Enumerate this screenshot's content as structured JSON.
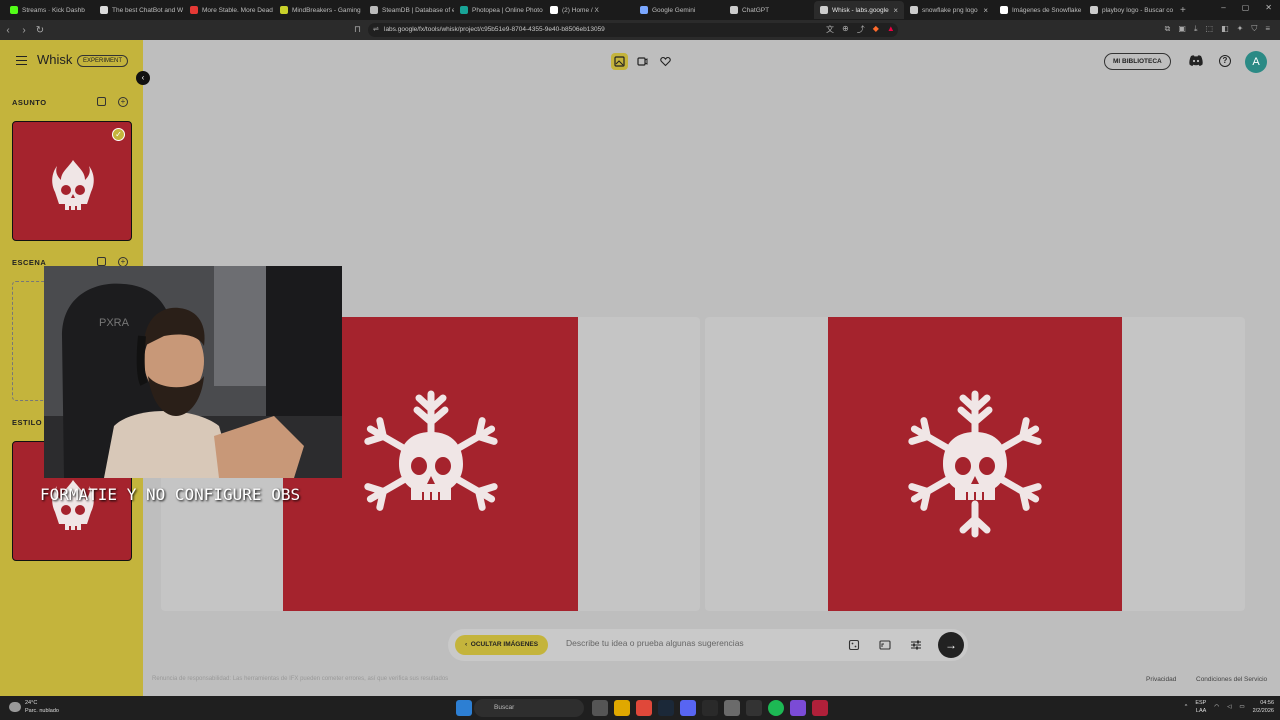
{
  "browser": {
    "tabs": [
      {
        "label": "Streams · Kick Dashb",
        "color": "#53fc18"
      },
      {
        "label": "The best ChatBot and W",
        "color": "#dddddd"
      },
      {
        "label": "More Stable. More Dead",
        "color": "#e53935"
      },
      {
        "label": "MindBreakers - Gaming",
        "color": "#c9d12a"
      },
      {
        "label": "SteamDB | Database of e",
        "color": "#bbbbbb"
      },
      {
        "label": "Photopea | Online Photo",
        "color": "#18a497"
      },
      {
        "label": "(2) Home / X",
        "color": "#ffffff"
      },
      {
        "label": "Google Gemini",
        "color": "#7aa7ff"
      },
      {
        "label": "ChatGPT",
        "color": "#cccccc"
      },
      {
        "label": "Whisk - labs.google",
        "color": "#cccccc"
      },
      {
        "label": "snowflake png logo",
        "color": "#cccccc"
      },
      {
        "label": "Imágenes de Snowflake",
        "color": "#ffffff"
      },
      {
        "label": "playboy logo - Buscar co",
        "color": "#cccccc"
      }
    ],
    "active_tab_index": 9,
    "url": "labs.google/fx/tools/whisk/project/c95b51e9-8704-4355-9e40-b8506eb13059",
    "window_controls": [
      "–",
      "▢",
      "✕"
    ],
    "new_tab": "+"
  },
  "app": {
    "logo": "Whisk",
    "badge": "EXPERIMENT",
    "sections": {
      "subject": "ASUNTO",
      "scene": "ESCENA",
      "style": "ESTILO"
    },
    "library_button": "MI BIBLIOTECA",
    "avatar_initial": "A",
    "hide_images_button": "OCULTAR IMÁGENES",
    "prompt_placeholder": "Describe tu idea o prueba algunas sugerencias",
    "disclaimer": "Renuncia de responsabilidad: Las herramientas de IFX pueden cometer errores, así que verifica sus resultados",
    "privacy_link": "Privacidad",
    "terms_link": "Condiciones del Servicio",
    "accent_color": "#c4b43c",
    "image_color": "#a5232d"
  },
  "overlay": {
    "caption": "FORMATIE Y NO CONFIGURE OBS"
  },
  "taskbar": {
    "weather_temp": "24°C",
    "weather_desc": "Parc. nublado",
    "search_placeholder": "Buscar",
    "lang": "ESP",
    "lang_sub": "LAA",
    "time": "04:56",
    "date": "2/2/2026"
  }
}
